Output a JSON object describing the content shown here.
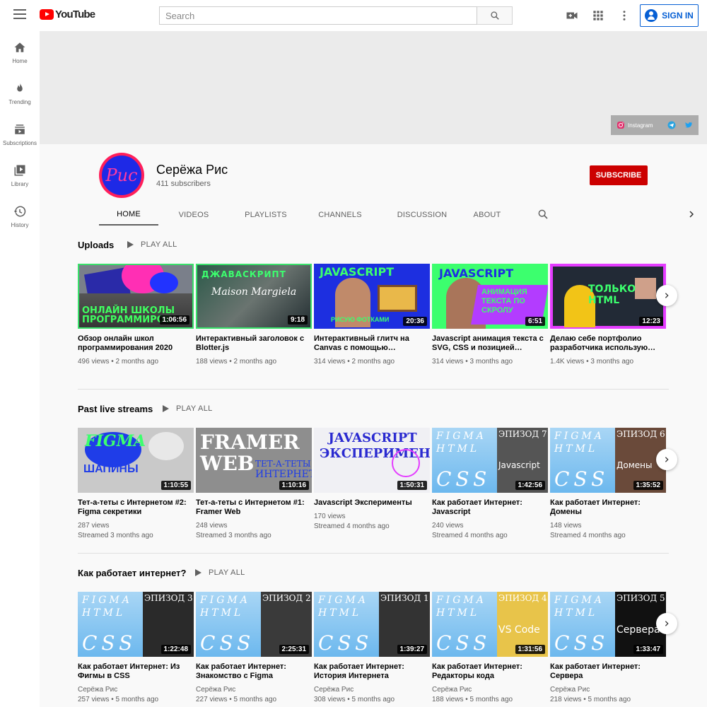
{
  "header": {
    "logo_text": "YouTube",
    "search_placeholder": "Search",
    "signin_label": "SIGN IN"
  },
  "sidebar": {
    "items": [
      {
        "label": "Home",
        "icon": "home-icon"
      },
      {
        "label": "Trending",
        "icon": "flame-icon"
      },
      {
        "label": "Subscriptions",
        "icon": "subscriptions-icon"
      },
      {
        "label": "Library",
        "icon": "library-icon"
      },
      {
        "label": "History",
        "icon": "history-icon"
      }
    ]
  },
  "banner": {
    "instagram_label": "Instagram"
  },
  "channel": {
    "avatar_text": "Рис",
    "name": "Серёжа Рис",
    "subscribers": "411 subscribers",
    "subscribe_label": "SUBSCRIBE",
    "tabs": [
      "HOME",
      "VIDEOS",
      "PLAYLISTS",
      "CHANNELS",
      "DISCUSSION",
      "ABOUT"
    ]
  },
  "sections": [
    {
      "title": "Uploads",
      "play_all": "PLAY ALL",
      "videos": [
        {
          "title": "Обзор онлайн школ программирования 2020",
          "duration": "1:06:56",
          "meta1": "496 views • 2 months ago",
          "thumb_text": "ОНЛАЙН ШКОЛЫ ПРОГРАММИРОВ"
        },
        {
          "title": "Интерактивный заголовок с Blotter.js",
          "duration": "9:18",
          "meta1": "188 views • 2 months ago",
          "thumb_text": "ДЖАВАСКРИПТ"
        },
        {
          "title": "Интерактивный глитч на Canvas с помощью…",
          "duration": "20:36",
          "meta1": "314 views • 2 months ago",
          "thumb_text": "JAVASCRIPT"
        },
        {
          "title": "Javascript анимация текста с SVG, CSS и позицией…",
          "duration": "6:51",
          "meta1": "314 views • 3 months ago",
          "thumb_text": "JAVASCRIPT"
        },
        {
          "title": "Делаю себе портфолио разработчика использую…",
          "duration": "12:23",
          "meta1": "1.4K views • 3 months ago",
          "thumb_text": "ТОЛЬКО HTML"
        }
      ]
    },
    {
      "title": "Past live streams",
      "play_all": "PLAY ALL",
      "videos": [
        {
          "title": "Тет-а-теты с Интернетом #2: Figma секретики",
          "duration": "1:10:55",
          "meta1": "287 views",
          "meta2": "Streamed 3 months ago",
          "thumb_text": "FIGMA"
        },
        {
          "title": "Тет-а-теты с Интернетом #1: Framer Web",
          "duration": "1:10:16",
          "meta1": "248 views",
          "meta2": "Streamed 3 months ago",
          "thumb_text": "FRAMER WEB"
        },
        {
          "title": "Javascript Эксперименты",
          "duration": "1:50:31",
          "meta1": "170 views",
          "meta2": "Streamed 4 months ago",
          "thumb_text": "JAVASCRIPT ЭКСПЕРИМЕНТЫ"
        },
        {
          "title": "Как работает Интернет: Javascript",
          "duration": "1:42:56",
          "meta1": "240 views",
          "meta2": "Streamed 4 months ago",
          "thumb_text": "ЭПИЗОД 7"
        },
        {
          "title": "Как работает Интернет: Домены",
          "duration": "1:35:52",
          "meta1": "148 views",
          "meta2": "Streamed 4 months ago",
          "thumb_text": "ЭПИЗОД 6"
        }
      ]
    },
    {
      "title": "Как работает интернет?",
      "play_all": "PLAY ALL",
      "videos": [
        {
          "title": "Как работает Интернет: Из Фигмы в CSS",
          "duration": "1:22:48",
          "meta1": "Серёжа Рис",
          "meta2": "257 views • 5 months ago",
          "thumb_text": "ЭПИЗОД 3"
        },
        {
          "title": "Как работает Интернет: Знакомство с Figma",
          "duration": "2:25:31",
          "meta1": "Серёжа Рис",
          "meta2": "227 views • 5 months ago",
          "thumb_text": "ЭПИЗОД 2"
        },
        {
          "title": "Как работает Интернет: История Интернета",
          "duration": "1:39:27",
          "meta1": "Серёжа Рис",
          "meta2": "308 views • 5 months ago",
          "thumb_text": "ЭПИЗОД 1"
        },
        {
          "title": "Как работает Интернет: Редакторы кода",
          "duration": "1:31:56",
          "meta1": "Серёжа Рис",
          "meta2": "188 views • 5 months ago",
          "thumb_text": "ЭПИЗОД 4"
        },
        {
          "title": "Как работает Интернет: Сервера",
          "duration": "1:33:47",
          "meta1": "Серёжа Рис",
          "meta2": "218 views • 5 months ago",
          "thumb_text": "ЭПИЗОД 5"
        }
      ]
    }
  ],
  "colors": {
    "brand_red": "#ff0000",
    "subscribe_red": "#cc0000",
    "signin_blue": "#065fd4"
  }
}
